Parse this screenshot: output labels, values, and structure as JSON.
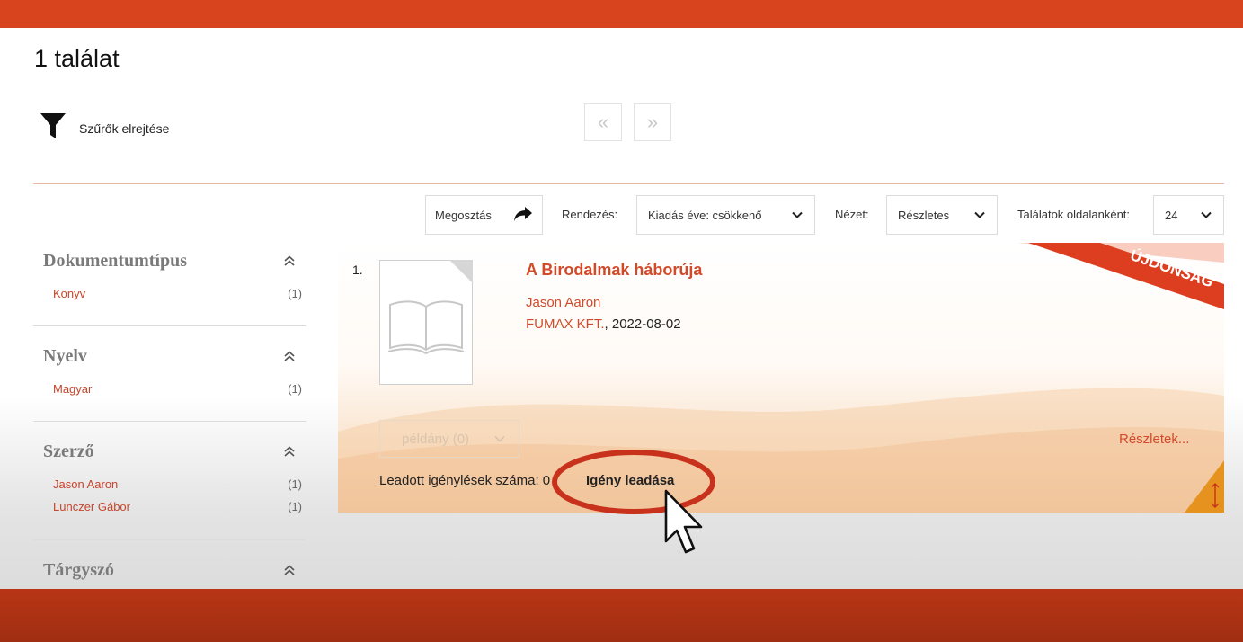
{
  "header": {
    "result_count": "1 találat"
  },
  "filters": {
    "toggle_label": "Szűrők elrejtése"
  },
  "pager": {
    "prev": "«",
    "next": "»"
  },
  "toolbar": {
    "share_label": "Megosztás",
    "sort_label": "Rendezés:",
    "sort_value": "Kiadás éve: csökkenő",
    "view_label": "Nézet:",
    "view_value": "Részletes",
    "per_page_label": "Találatok oldalanként:",
    "per_page_value": "24"
  },
  "facets": [
    {
      "title": "Dokumentumtípus",
      "items": [
        {
          "name": "Könyv",
          "count": "(1)"
        }
      ]
    },
    {
      "title": "Nyelv",
      "items": [
        {
          "name": "Magyar",
          "count": "(1)"
        }
      ]
    },
    {
      "title": "Szerző",
      "items": [
        {
          "name": "Jason Aaron",
          "count": "(1)"
        },
        {
          "name": "Lunczer Gábor",
          "count": "(1)"
        }
      ]
    },
    {
      "title": "Tárgyszó",
      "items": []
    }
  ],
  "result": {
    "number": "1.",
    "title": "A Birodalmak háborúja",
    "author": "Jason Aaron",
    "publisher": "FUMAX KFT.",
    "date": ", 2022-08-02",
    "ribbon": "ÚJDONSÁG",
    "copies": "példány (0)",
    "request_count": "Leadott igénylések száma: 0",
    "request_button": "Igény leadása",
    "details_link": "Részletek..."
  },
  "colors": {
    "brand": "#d7441d",
    "link": "#d24a2a",
    "highlight_ring": "#c8321c"
  }
}
